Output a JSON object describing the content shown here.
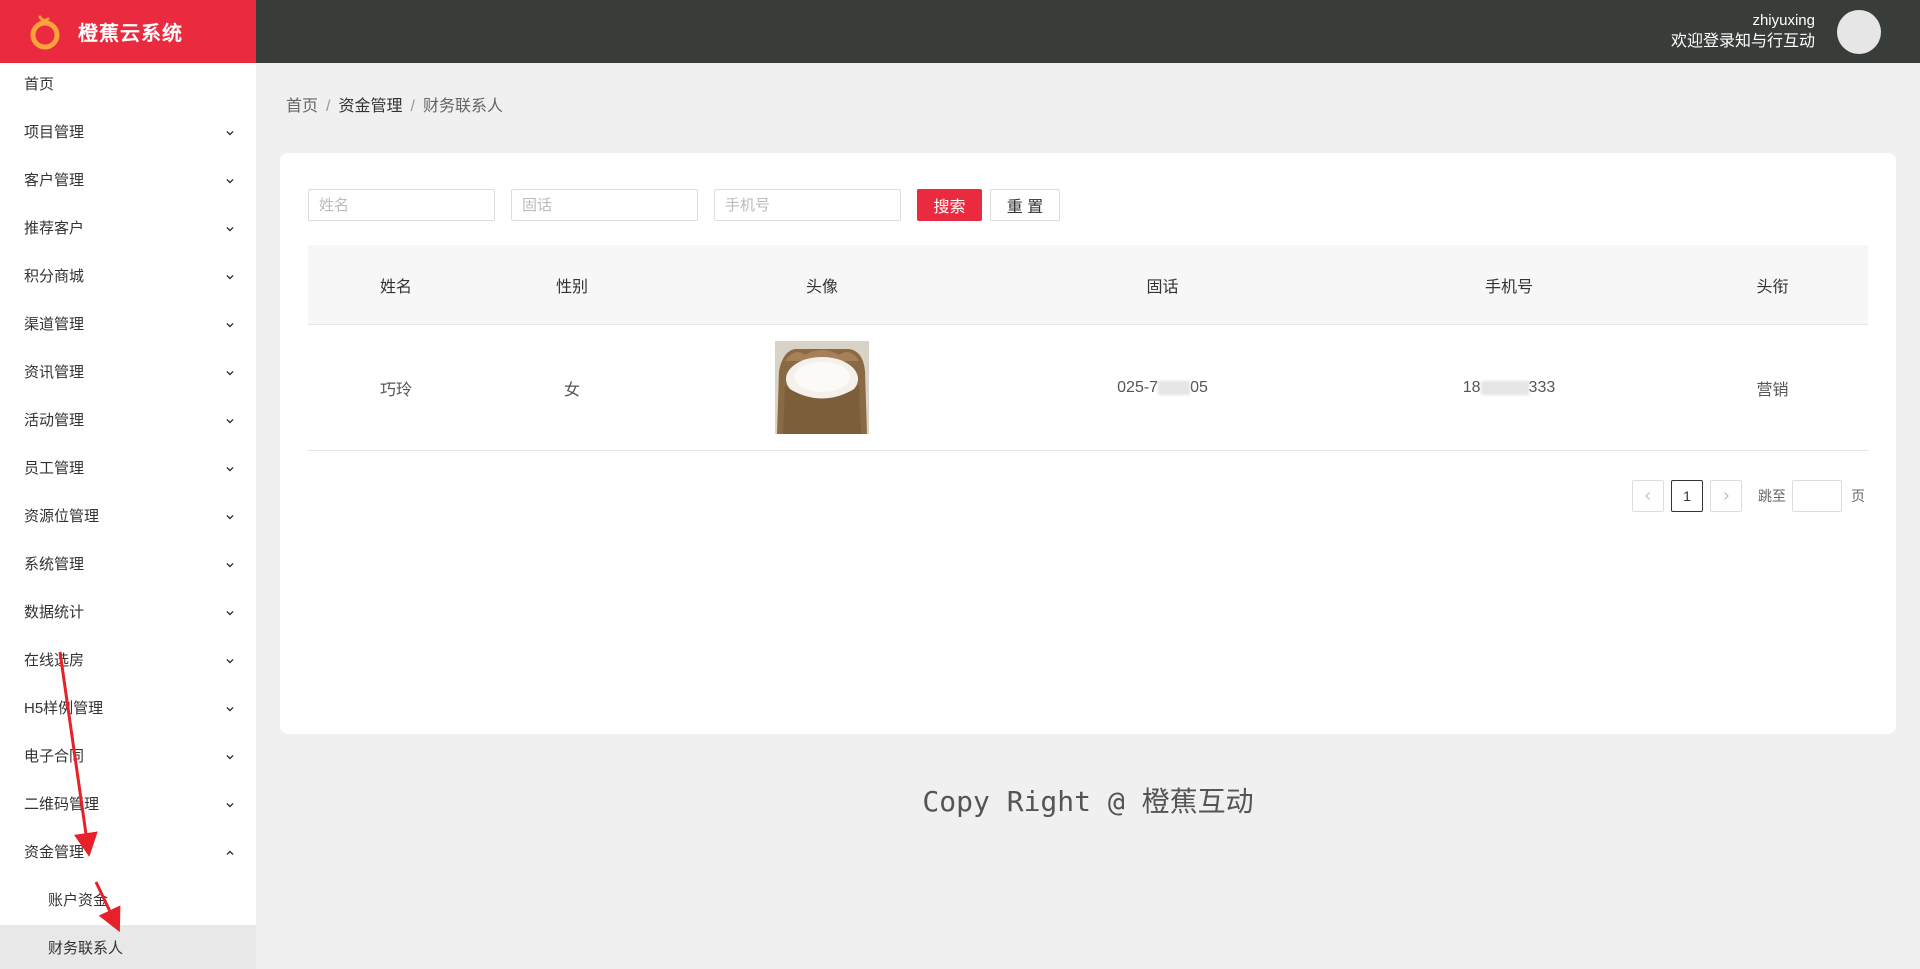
{
  "brand": {
    "name": "橙蕉云系统",
    "color": "#ea2a3e"
  },
  "user": {
    "name": "zhiyuxing",
    "welcome": "欢迎登录知与行互动"
  },
  "sidebar": {
    "home": "首页",
    "items": [
      {
        "label": "项目管理"
      },
      {
        "label": "客户管理"
      },
      {
        "label": "推荐客户"
      },
      {
        "label": "积分商城"
      },
      {
        "label": "渠道管理"
      },
      {
        "label": "资讯管理"
      },
      {
        "label": "活动管理"
      },
      {
        "label": "员工管理"
      },
      {
        "label": "资源位管理"
      },
      {
        "label": "系统管理"
      },
      {
        "label": "数据统计"
      },
      {
        "label": "在线选房"
      },
      {
        "label": "H5样例管理"
      },
      {
        "label": "电子合同"
      },
      {
        "label": "二维码管理"
      },
      {
        "label": "资金管理"
      }
    ],
    "submenu": [
      {
        "label": "账户资金"
      },
      {
        "label": "财务联系人"
      }
    ]
  },
  "breadcrumb": [
    "首页",
    "资金管理",
    "财务联系人"
  ],
  "search": {
    "name_placeholder": "姓名",
    "phone_placeholder": "固话",
    "mobile_placeholder": "手机号",
    "search_label": "搜索",
    "reset_label": "重 置"
  },
  "table": {
    "headers": [
      "姓名",
      "性别",
      "头像",
      "固话",
      "手机号",
      "头衔"
    ],
    "rows": [
      {
        "name": "巧玲",
        "gender": "女",
        "avatar": "rice-sack-image",
        "phone_prefix": "025-7",
        "phone_suffix": "05",
        "mobile_prefix": "18",
        "mobile_suffix": "333",
        "title": "营销"
      }
    ]
  },
  "pagination": {
    "current": "1",
    "jump_label": "跳至",
    "page_unit": "页"
  },
  "footer": "Copy Right @ 橙蕉互动",
  "colors": {
    "topbar": "#393d3a",
    "accent": "#ea2a3e",
    "annotation": "#e8202a"
  }
}
